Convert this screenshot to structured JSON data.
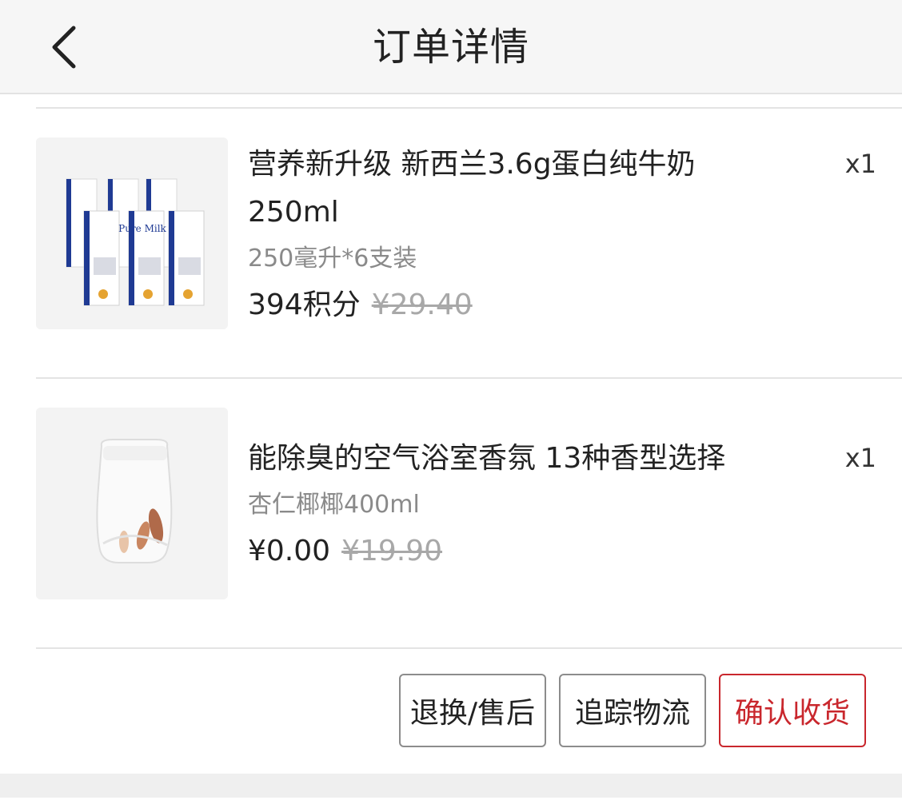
{
  "header": {
    "title": "订单详情",
    "back_icon": "chevron-left-icon"
  },
  "products": [
    {
      "name_line1": "营养新升级 新西兰3.6g蛋白纯牛奶",
      "name_line2": "250ml",
      "spec": "250毫升*6支装",
      "price": "394积分",
      "original_price": "¥29.40",
      "quantity": "x1",
      "image_brand_text": "Pure Milk"
    },
    {
      "name_line1": "能除臭的空气浴室香氛 13种香型选择",
      "spec": "杏仁椰椰400ml",
      "price": "¥0.00",
      "original_price": "¥19.90",
      "quantity": "x1"
    }
  ],
  "actions": {
    "return_label": "退换/售后",
    "track_label": "追踪物流",
    "confirm_label": "确认收货"
  },
  "colors": {
    "accent": "#c9272d",
    "header_bg": "#f6f6f6",
    "muted_text": "#8a8a8a"
  }
}
